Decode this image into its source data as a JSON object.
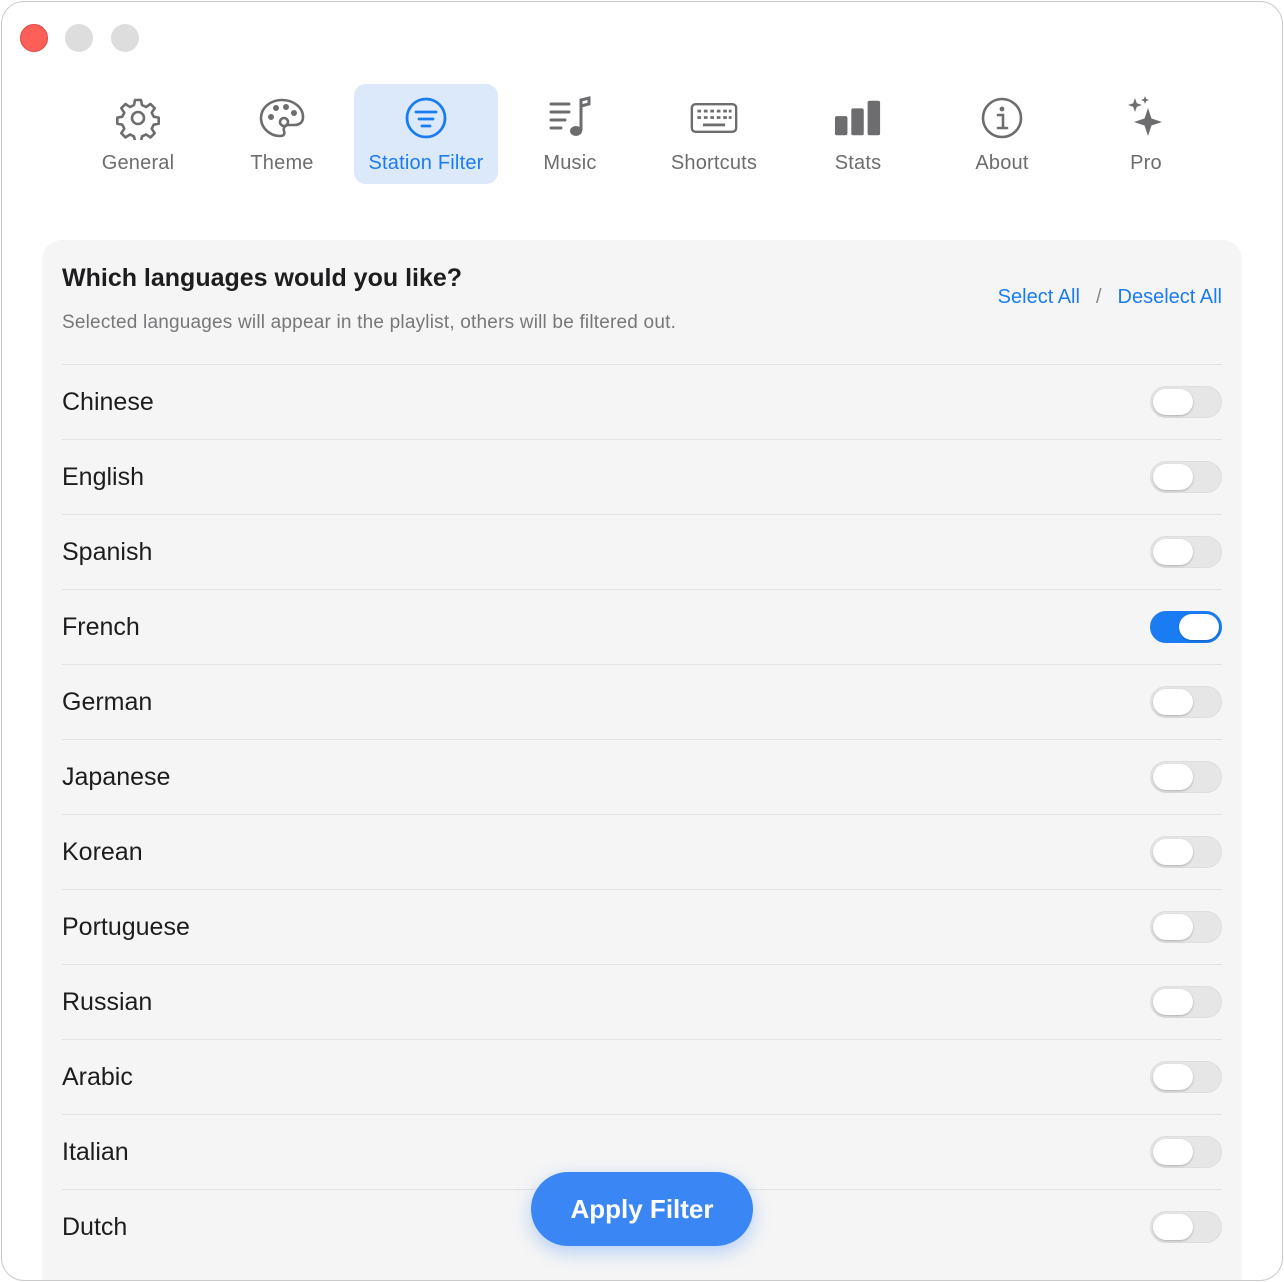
{
  "window": {
    "controls": [
      "close",
      "minimize",
      "maximize"
    ]
  },
  "tabs": [
    {
      "label": "General",
      "icon": "gear-icon",
      "active": false
    },
    {
      "label": "Theme",
      "icon": "palette-icon",
      "active": false
    },
    {
      "label": "Station Filter",
      "icon": "filter-icon",
      "active": true
    },
    {
      "label": "Music",
      "icon": "music-list-icon",
      "active": false
    },
    {
      "label": "Shortcuts",
      "icon": "keyboard-icon",
      "active": false
    },
    {
      "label": "Stats",
      "icon": "bar-chart-icon",
      "active": false
    },
    {
      "label": "About",
      "icon": "info-icon",
      "active": false
    },
    {
      "label": "Pro",
      "icon": "sparkles-icon",
      "active": false
    }
  ],
  "filter": {
    "title": "Which languages would you like?",
    "subtitle": "Selected languages will appear in the playlist, others will be filtered out.",
    "select_all": "Select All",
    "separator": "/",
    "deselect_all": "Deselect All"
  },
  "languages": [
    {
      "name": "Chinese",
      "enabled": false
    },
    {
      "name": "English",
      "enabled": false
    },
    {
      "name": "Spanish",
      "enabled": false
    },
    {
      "name": "French",
      "enabled": true
    },
    {
      "name": "German",
      "enabled": false
    },
    {
      "name": "Japanese",
      "enabled": false
    },
    {
      "name": "Korean",
      "enabled": false
    },
    {
      "name": "Portuguese",
      "enabled": false
    },
    {
      "name": "Russian",
      "enabled": false
    },
    {
      "name": "Arabic",
      "enabled": false
    },
    {
      "name": "Italian",
      "enabled": false
    },
    {
      "name": "Dutch",
      "enabled": false
    }
  ],
  "apply_button": "Apply Filter",
  "colors": {
    "accent": "#1a7cf3",
    "close": "#fe5f57",
    "active_tab_bg": "#dce9fb"
  }
}
